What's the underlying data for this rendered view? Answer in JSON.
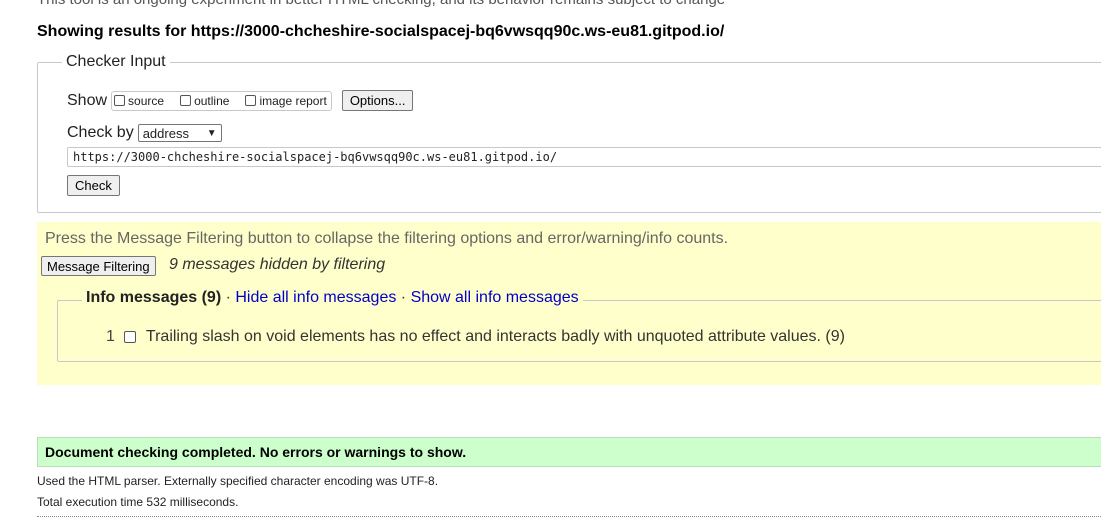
{
  "top_note": "This tool is an ongoing experiment in better HTML checking, and its behavior remains subject to change",
  "results_heading": "Showing results for https://3000-chcheshire-socialspacej-bq6vwsqq90c.ws-eu81.gitpod.io/",
  "checker": {
    "legend": "Checker Input",
    "show_label": "Show",
    "options": [
      "source",
      "outline",
      "image report"
    ],
    "options_button": "Options...",
    "check_by_label": "Check by",
    "check_by_value": "address",
    "url_value": "https://3000-chcheshire-socialspacej-bq6vwsqq90c.ws-eu81.gitpod.io/",
    "check_button": "Check"
  },
  "filtering": {
    "note": "Press the Message Filtering button to collapse the filtering options and error/warning/info counts.",
    "button": "Message Filtering",
    "hidden_count": "9 messages hidden by filtering",
    "info": {
      "title": "Info messages (9)",
      "separator": " · ",
      "hide_link": "Hide all info messages",
      "show_link": "Show all info messages",
      "messages": [
        {
          "num": "1",
          "text": "Trailing slash on void elements has no effect and interacts badly with unquoted attribute values. (9)"
        }
      ]
    }
  },
  "success_message": "Document checking completed. No errors or warnings to show.",
  "parser_info": "Used the HTML parser. Externally specified character encoding was UTF-8.",
  "execution_time": "Total execution time 532 milliseconds.",
  "colors": {
    "filter_bg": "#ffffcc",
    "success_bg": "#ccffcc",
    "link": "#0000cc"
  }
}
